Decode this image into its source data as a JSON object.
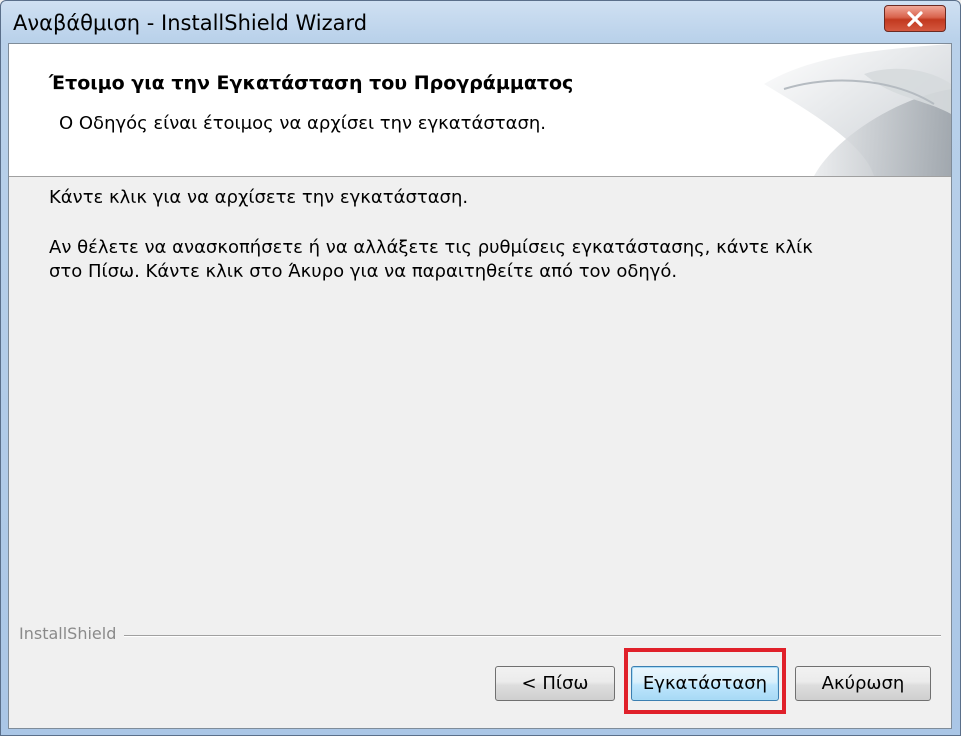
{
  "window": {
    "title": "Αναβάθμιση - InstallShield Wizard",
    "close_glyph": "x"
  },
  "header": {
    "title": "Έτοιμο για την Εγκατάσταση του Προγράμματος",
    "subtitle": "Ο Οδηγός είναι έτοιμος να αρχίσει την εγκατάσταση."
  },
  "body": {
    "line1": "Κάντε κλικ για να αρχίσετε την εγκατάσταση.",
    "line2": "Αν θέλετε να ανασκοπήσετε ή να αλλάξετε τις ρυθμίσεις εγκατάστασης, κάντε κλίκ",
    "line3": "στο Πίσω. Κάντε κλικ στο Άκυρο για να παραιτηθείτε από τον οδηγό."
  },
  "footer": {
    "brand": "InstallShield",
    "back_label": "< Πίσω",
    "install_label": "Εγκατάσταση",
    "cancel_label": "Ακύρωση"
  },
  "colors": {
    "highlight": "#e0202a",
    "close_button": "#c2391f",
    "default_button_border": "#3c7fb1"
  },
  "icons": {
    "close": "close-icon",
    "header_graphic": "installshield-swirl-graphic"
  }
}
